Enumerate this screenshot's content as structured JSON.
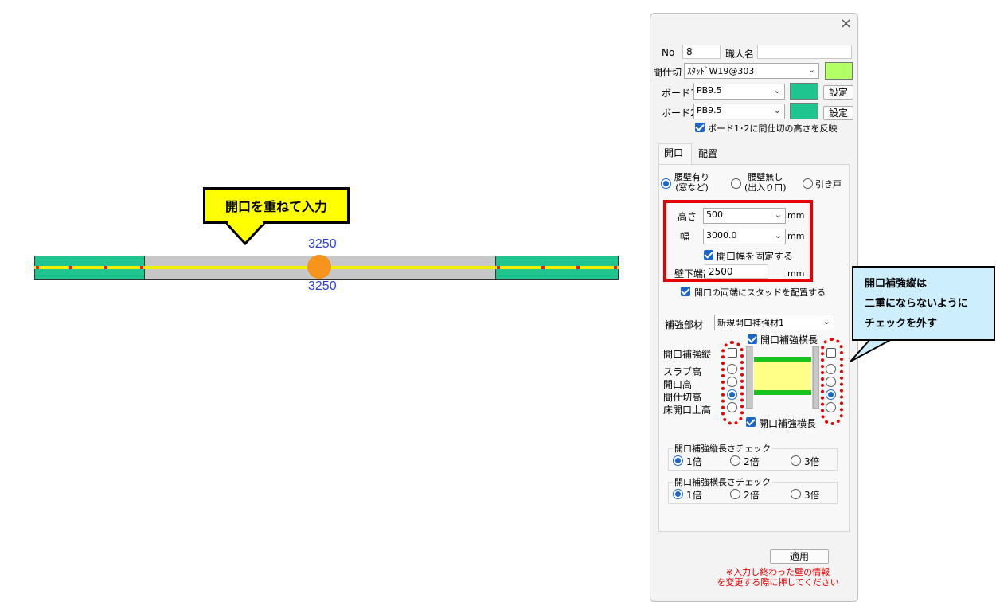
{
  "canvas": {
    "callout_label": "開口を重ねて入力",
    "dim_top": "3250",
    "dim_bottom": "3250",
    "wall_colors": {
      "board": "#1fc48f",
      "opening": "#c8c8c8",
      "stud_line": "#f4f000",
      "marker": "#e31b1b",
      "opening_point": "#f7941d"
    }
  },
  "dialog": {
    "close_glyph": "×",
    "no_label": "No",
    "no_value": "8",
    "craftsman_label": "職人名",
    "craftsman_value": "",
    "partition_label": "間仕切",
    "partition_value": "ｽﾀｯﾄﾞW19@303",
    "partition_color": "#b3ff66",
    "board1_label": "ボード1",
    "board1_value": "PB9.5",
    "board1_color": "#1fc48f",
    "board2_label": "ボード2",
    "board2_value": "PB9.5",
    "board2_color": "#1fc48f",
    "settings_button": "設定",
    "reflect_height_label": "ボード1･2に間仕切の高さを反映",
    "reflect_height_checked": true,
    "tabs": [
      {
        "label": "開口",
        "active": true
      },
      {
        "label": "配置",
        "active": false
      }
    ],
    "opening_type": {
      "options": [
        {
          "line1": "腰壁有り",
          "line2": "(窓など)",
          "selected": true
        },
        {
          "line1": "腰壁無し",
          "line2": "(出入り口)",
          "selected": false
        },
        {
          "line1": "引き戸",
          "line2": "",
          "selected": false
        }
      ]
    },
    "height_label": "高さ",
    "height_value": "500",
    "width_label": "幅",
    "width_value": "3000.0",
    "unit_mm": "mm",
    "fix_width_label": "開口幅を固定する",
    "fix_width_checked": true,
    "wall_bottom_label": "壁下端高",
    "wall_bottom_value": "2500",
    "place_studs_label": "開口の両端にスタッドを配置する",
    "place_studs_checked": true,
    "reinforce_member_label": "補強部材",
    "reinforce_member_value": "新規開口補強材1",
    "horizontal_top_label": "開口補強横長",
    "horizontal_top_checked": true,
    "horizontal_bottom_label": "開口補強横長",
    "horizontal_bottom_checked": true,
    "vertical_label": "開口補強縦",
    "left_vertical_checked": false,
    "right_vertical_checked": false,
    "height_options": [
      "スラブ高",
      "開口高",
      "間仕切高",
      "床開口上高"
    ],
    "left_selected_index": 2,
    "right_selected_index": 2,
    "vertical_length_check": {
      "title": "開口補強縦長さチェック",
      "options": [
        "1倍",
        "2倍",
        "3倍"
      ],
      "selected_index": 0
    },
    "horizontal_length_check": {
      "title": "開口補強横長さチェック",
      "options": [
        "1倍",
        "2倍",
        "3倍"
      ],
      "selected_index": 0
    },
    "apply_button": "適用",
    "note_line1": "※入力し終わった壁の情報",
    "note_line2": "を変更する際に押してください"
  },
  "callout2": {
    "line1": "開口補強縦は",
    "line2": "二重にならないように",
    "line3": "チェックを外す"
  }
}
